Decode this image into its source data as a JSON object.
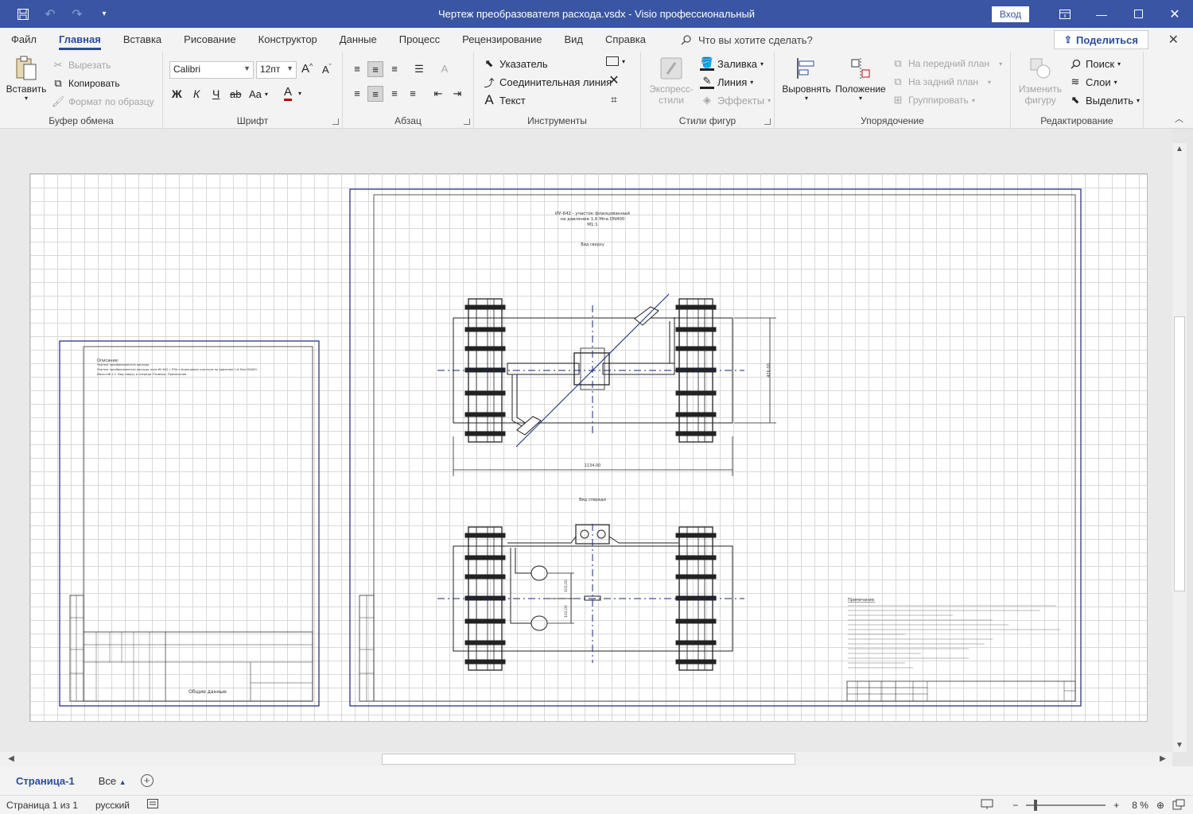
{
  "titlebar": {
    "title": "Чертеж преобразователя расхода.vsdx  -  Visio профессиональный",
    "signin": "Вход"
  },
  "menu": {
    "tabs": [
      "Файл",
      "Главная",
      "Вставка",
      "Рисование",
      "Конструктор",
      "Данные",
      "Процесс",
      "Рецензирование",
      "Вид",
      "Справка"
    ],
    "active_tab": "Главная",
    "tell_me": "Что вы хотите сделать?",
    "share": "Поделиться"
  },
  "ribbon": {
    "clipboard": {
      "label": "Буфер обмена",
      "paste": "Вставить",
      "cut": "Вырезать",
      "copy": "Копировать",
      "format_painter": "Формат по образцу"
    },
    "font": {
      "label": "Шрифт",
      "font_name": "Calibri",
      "font_size": "12пт",
      "bold": "Ж",
      "italic": "К",
      "underline": "Ч",
      "strike": "ab",
      "case": "Aa",
      "color_letter": "A",
      "grow": "A",
      "shrink": "A"
    },
    "paragraph": {
      "label": "Абзац"
    },
    "tools": {
      "label": "Инструменты",
      "pointer": "Указатель",
      "connector": "Соединительная линия",
      "text": "Текст"
    },
    "shape_styles": {
      "label": "Стили фигур",
      "express": "Экспресс-",
      "express2": "стили",
      "fill": "Заливка",
      "line": "Линия",
      "effects": "Эффекты"
    },
    "arrange": {
      "label": "Упорядочение",
      "align": "Выровнять",
      "position": "Положение",
      "bring_front": "На передний план",
      "send_back": "На задний план",
      "group": "Группировать"
    },
    "editing": {
      "label": "Редактирование",
      "change_shape": "Изменить",
      "change_shape2": "фигуру",
      "find": "Поиск",
      "layers": "Слои",
      "select": "Выделить"
    }
  },
  "drawing": {
    "title_line1": "ИУ-642 - участок фланцованный",
    "title_line2": "на давление 1,6 Мпа DN400",
    "title_line3": "М1:1",
    "view_top": "Вид сверху",
    "view_front": "Вид спереди",
    "dim_width": "1134,00",
    "dim_height": "426,00",
    "dim_small1": "102,00",
    "dim_small2": "102,00",
    "left_sheet_header": "Описание:",
    "left_sheet_line1": "Чертеж преобразователя расхода",
    "left_sheet_line2": "Чертеж преобразователя расхода типа ИУ-642 с ПЗА с фланцевым участком на давление 1,6 Мпа DN400.",
    "left_sheet_line3": "Масштаб 1:1. Вид сверху и спереди. Размеры. Примечания.",
    "left_sheet_stamp": "Общие данные",
    "notes_header": "Примечание:"
  },
  "pages": {
    "current": "Страница-1",
    "all": "Все"
  },
  "status": {
    "page": "Страница 1 из 1",
    "language": "русский",
    "zoom": "8 %",
    "zoom_value": 8
  }
}
